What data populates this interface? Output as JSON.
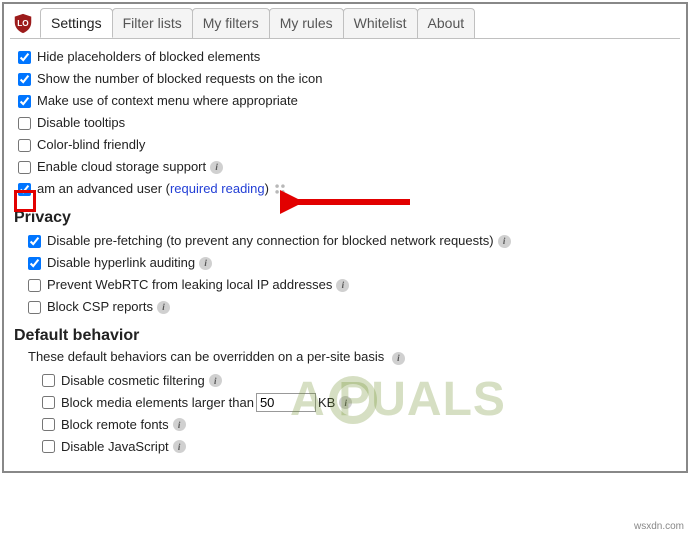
{
  "tabs": {
    "t0": "Settings",
    "t1": "Filter lists",
    "t2": "My filters",
    "t3": "My rules",
    "t4": "Whitelist",
    "t5": "About"
  },
  "general": {
    "o0": "Hide placeholders of blocked elements",
    "o1": "Show the number of blocked requests on the icon",
    "o2": "Make use of context menu where appropriate",
    "o3": "Disable tooltips",
    "o4": "Color-blind friendly",
    "o5": "Enable cloud storage support",
    "adv_prefix": " am an advanced user (",
    "adv_link": "required reading",
    "adv_suffix": ")"
  },
  "privacy": {
    "heading": "Privacy",
    "p0": "Disable pre-fetching (to prevent any connection for blocked network requests)",
    "p1": "Disable hyperlink auditing",
    "p2": "Prevent WebRTC from leaking local IP addresses",
    "p3": "Block CSP reports"
  },
  "defaultb": {
    "heading": "Default behavior",
    "sub": "These default behaviors can be overridden on a per-site basis",
    "d0": "Disable cosmetic filtering",
    "d1_pre": "Block media elements larger than",
    "d1_val": "50",
    "d1_post": "KB",
    "d2": "Block remote fonts",
    "d3": "Disable JavaScript"
  },
  "watermark": "A   PUALS",
  "footer": "wsxdn.com"
}
